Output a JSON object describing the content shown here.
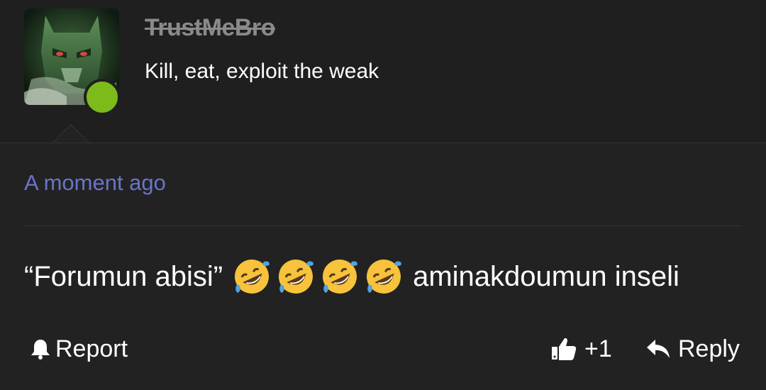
{
  "post": {
    "author": {
      "username": "TrustMeBro",
      "title": "Kill, eat, exploit the weak",
      "avatar_icon": "masked-hero-avatar",
      "online_status_color": "#7cbb1a"
    },
    "timestamp": "A moment ago",
    "message": {
      "before": "“Forumun abisi”",
      "emojis": [
        "rolling-on-floor-laughing-emoji",
        "rolling-on-floor-laughing-emoji",
        "rolling-on-floor-laughing-emoji",
        "rolling-on-floor-laughing-emoji"
      ],
      "after": "aminakdoumun inseli"
    },
    "actions": {
      "report_label": "Report",
      "like_count": "+1",
      "reply_label": "Reply"
    }
  },
  "colors": {
    "background": "#222222",
    "header_background": "#1f1f1f",
    "timestamp": "#6a74c9",
    "username": "#8a8a8a"
  }
}
